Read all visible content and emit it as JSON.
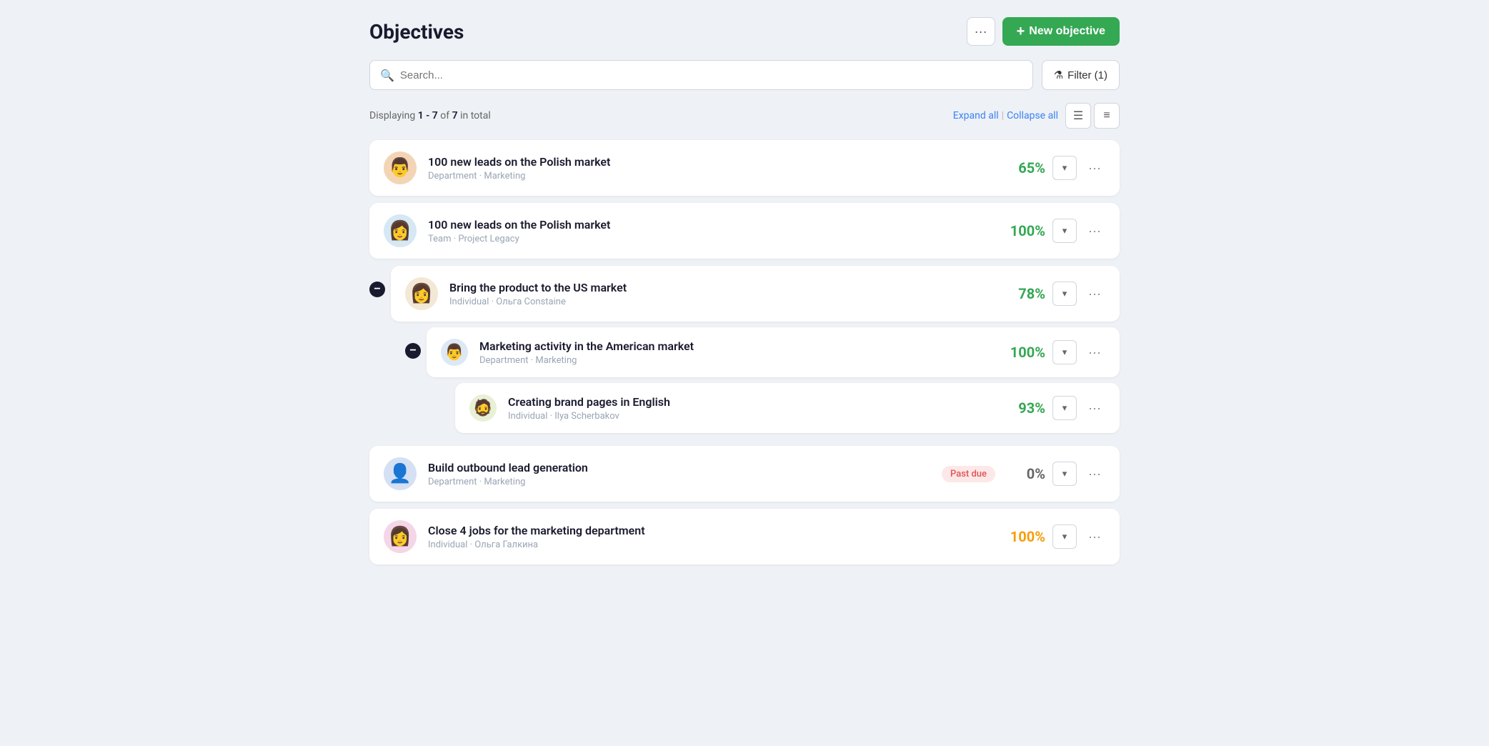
{
  "page": {
    "title": "Objectives",
    "more_label": "···",
    "new_objective_label": "New objective",
    "search_placeholder": "Search...",
    "filter_label": "Filter (1)",
    "display_text_prefix": "Displaying",
    "display_range": "1 - 7",
    "display_of": "of",
    "display_total": "7",
    "display_suffix": "in total",
    "expand_all_label": "Expand all",
    "collapse_all_label": "Collapse all"
  },
  "objectives": [
    {
      "id": 1,
      "title": "100 new leads on the Polish market",
      "subtitle": "Department · Marketing",
      "percent": "65%",
      "percent_color": "green",
      "avatar_emoji": "👨",
      "avatar_bg": "#f3d5b5"
    },
    {
      "id": 2,
      "title": "100 new leads on the Polish market",
      "subtitle": "Team · Project Legacy",
      "percent": "100%",
      "percent_color": "green",
      "avatar_emoji": "👩",
      "avatar_bg": "#d5e8f3"
    },
    {
      "id": 3,
      "title": "Bring the product to the US market",
      "subtitle": "Individual · Ольга Constaine",
      "percent": "78%",
      "percent_color": "green",
      "avatar_emoji": "👩",
      "avatar_bg": "#f3e8d5",
      "collapsible": true,
      "children": [
        {
          "id": 31,
          "title": "Marketing activity in the American market",
          "subtitle": "Department · Marketing",
          "percent": "100%",
          "percent_color": "green",
          "avatar_emoji": "👨",
          "avatar_bg": "#dde8f5",
          "collapsible": true,
          "children": [
            {
              "id": 311,
              "title": "Creating brand pages in English",
              "subtitle": "Individual · Ilya Scherbakov",
              "percent": "93%",
              "percent_color": "green",
              "avatar_emoji": "🧔",
              "avatar_bg": "#e8f0d5"
            }
          ]
        }
      ]
    },
    {
      "id": 4,
      "title": "Build outbound lead generation",
      "subtitle": "Department · Marketing",
      "percent": "0%",
      "percent_color": "gray",
      "past_due": true,
      "avatar_emoji": "👤",
      "avatar_bg": "#d5e0f3"
    },
    {
      "id": 5,
      "title": "Close 4 jobs for the marketing department",
      "subtitle": "Individual · Ольга Галкина",
      "percent": "100%",
      "percent_color": "orange",
      "avatar_emoji": "👩",
      "avatar_bg": "#f5d5e8"
    }
  ],
  "labels": {
    "past_due": "Past due",
    "dropdown_chevron": "▾",
    "dots": "···",
    "collapse_icon": "−",
    "plus_icon": "+"
  }
}
